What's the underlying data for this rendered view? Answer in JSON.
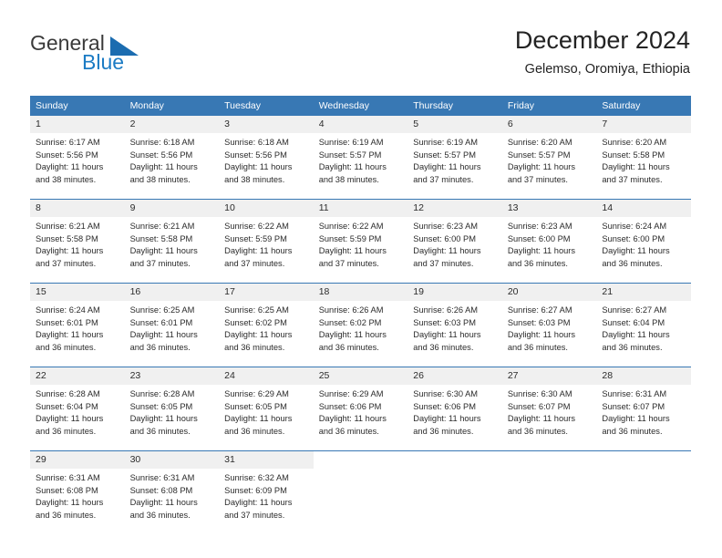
{
  "brand": {
    "name_top": "General",
    "name_bottom": "Blue",
    "accent_color": "#1b7bc4",
    "triangle_color": "#1b6cb0"
  },
  "header": {
    "title": "December 2024",
    "location": "Gelemso, Oromiya, Ethiopia"
  },
  "calendar": {
    "header_bg": "#3878b4",
    "daynum_bg": "#f0f0f0",
    "weekday_headers": [
      "Sunday",
      "Monday",
      "Tuesday",
      "Wednesday",
      "Thursday",
      "Friday",
      "Saturday"
    ],
    "weeks": [
      [
        {
          "day": "1",
          "sunrise": "Sunrise: 6:17 AM",
          "sunset": "Sunset: 5:56 PM",
          "daylight_1": "Daylight: 11 hours",
          "daylight_2": "and 38 minutes."
        },
        {
          "day": "2",
          "sunrise": "Sunrise: 6:18 AM",
          "sunset": "Sunset: 5:56 PM",
          "daylight_1": "Daylight: 11 hours",
          "daylight_2": "and 38 minutes."
        },
        {
          "day": "3",
          "sunrise": "Sunrise: 6:18 AM",
          "sunset": "Sunset: 5:56 PM",
          "daylight_1": "Daylight: 11 hours",
          "daylight_2": "and 38 minutes."
        },
        {
          "day": "4",
          "sunrise": "Sunrise: 6:19 AM",
          "sunset": "Sunset: 5:57 PM",
          "daylight_1": "Daylight: 11 hours",
          "daylight_2": "and 38 minutes."
        },
        {
          "day": "5",
          "sunrise": "Sunrise: 6:19 AM",
          "sunset": "Sunset: 5:57 PM",
          "daylight_1": "Daylight: 11 hours",
          "daylight_2": "and 37 minutes."
        },
        {
          "day": "6",
          "sunrise": "Sunrise: 6:20 AM",
          "sunset": "Sunset: 5:57 PM",
          "daylight_1": "Daylight: 11 hours",
          "daylight_2": "and 37 minutes."
        },
        {
          "day": "7",
          "sunrise": "Sunrise: 6:20 AM",
          "sunset": "Sunset: 5:58 PM",
          "daylight_1": "Daylight: 11 hours",
          "daylight_2": "and 37 minutes."
        }
      ],
      [
        {
          "day": "8",
          "sunrise": "Sunrise: 6:21 AM",
          "sunset": "Sunset: 5:58 PM",
          "daylight_1": "Daylight: 11 hours",
          "daylight_2": "and 37 minutes."
        },
        {
          "day": "9",
          "sunrise": "Sunrise: 6:21 AM",
          "sunset": "Sunset: 5:58 PM",
          "daylight_1": "Daylight: 11 hours",
          "daylight_2": "and 37 minutes."
        },
        {
          "day": "10",
          "sunrise": "Sunrise: 6:22 AM",
          "sunset": "Sunset: 5:59 PM",
          "daylight_1": "Daylight: 11 hours",
          "daylight_2": "and 37 minutes."
        },
        {
          "day": "11",
          "sunrise": "Sunrise: 6:22 AM",
          "sunset": "Sunset: 5:59 PM",
          "daylight_1": "Daylight: 11 hours",
          "daylight_2": "and 37 minutes."
        },
        {
          "day": "12",
          "sunrise": "Sunrise: 6:23 AM",
          "sunset": "Sunset: 6:00 PM",
          "daylight_1": "Daylight: 11 hours",
          "daylight_2": "and 37 minutes."
        },
        {
          "day": "13",
          "sunrise": "Sunrise: 6:23 AM",
          "sunset": "Sunset: 6:00 PM",
          "daylight_1": "Daylight: 11 hours",
          "daylight_2": "and 36 minutes."
        },
        {
          "day": "14",
          "sunrise": "Sunrise: 6:24 AM",
          "sunset": "Sunset: 6:00 PM",
          "daylight_1": "Daylight: 11 hours",
          "daylight_2": "and 36 minutes."
        }
      ],
      [
        {
          "day": "15",
          "sunrise": "Sunrise: 6:24 AM",
          "sunset": "Sunset: 6:01 PM",
          "daylight_1": "Daylight: 11 hours",
          "daylight_2": "and 36 minutes."
        },
        {
          "day": "16",
          "sunrise": "Sunrise: 6:25 AM",
          "sunset": "Sunset: 6:01 PM",
          "daylight_1": "Daylight: 11 hours",
          "daylight_2": "and 36 minutes."
        },
        {
          "day": "17",
          "sunrise": "Sunrise: 6:25 AM",
          "sunset": "Sunset: 6:02 PM",
          "daylight_1": "Daylight: 11 hours",
          "daylight_2": "and 36 minutes."
        },
        {
          "day": "18",
          "sunrise": "Sunrise: 6:26 AM",
          "sunset": "Sunset: 6:02 PM",
          "daylight_1": "Daylight: 11 hours",
          "daylight_2": "and 36 minutes."
        },
        {
          "day": "19",
          "sunrise": "Sunrise: 6:26 AM",
          "sunset": "Sunset: 6:03 PM",
          "daylight_1": "Daylight: 11 hours",
          "daylight_2": "and 36 minutes."
        },
        {
          "day": "20",
          "sunrise": "Sunrise: 6:27 AM",
          "sunset": "Sunset: 6:03 PM",
          "daylight_1": "Daylight: 11 hours",
          "daylight_2": "and 36 minutes."
        },
        {
          "day": "21",
          "sunrise": "Sunrise: 6:27 AM",
          "sunset": "Sunset: 6:04 PM",
          "daylight_1": "Daylight: 11 hours",
          "daylight_2": "and 36 minutes."
        }
      ],
      [
        {
          "day": "22",
          "sunrise": "Sunrise: 6:28 AM",
          "sunset": "Sunset: 6:04 PM",
          "daylight_1": "Daylight: 11 hours",
          "daylight_2": "and 36 minutes."
        },
        {
          "day": "23",
          "sunrise": "Sunrise: 6:28 AM",
          "sunset": "Sunset: 6:05 PM",
          "daylight_1": "Daylight: 11 hours",
          "daylight_2": "and 36 minutes."
        },
        {
          "day": "24",
          "sunrise": "Sunrise: 6:29 AM",
          "sunset": "Sunset: 6:05 PM",
          "daylight_1": "Daylight: 11 hours",
          "daylight_2": "and 36 minutes."
        },
        {
          "day": "25",
          "sunrise": "Sunrise: 6:29 AM",
          "sunset": "Sunset: 6:06 PM",
          "daylight_1": "Daylight: 11 hours",
          "daylight_2": "and 36 minutes."
        },
        {
          "day": "26",
          "sunrise": "Sunrise: 6:30 AM",
          "sunset": "Sunset: 6:06 PM",
          "daylight_1": "Daylight: 11 hours",
          "daylight_2": "and 36 minutes."
        },
        {
          "day": "27",
          "sunrise": "Sunrise: 6:30 AM",
          "sunset": "Sunset: 6:07 PM",
          "daylight_1": "Daylight: 11 hours",
          "daylight_2": "and 36 minutes."
        },
        {
          "day": "28",
          "sunrise": "Sunrise: 6:31 AM",
          "sunset": "Sunset: 6:07 PM",
          "daylight_1": "Daylight: 11 hours",
          "daylight_2": "and 36 minutes."
        }
      ],
      [
        {
          "day": "29",
          "sunrise": "Sunrise: 6:31 AM",
          "sunset": "Sunset: 6:08 PM",
          "daylight_1": "Daylight: 11 hours",
          "daylight_2": "and 36 minutes."
        },
        {
          "day": "30",
          "sunrise": "Sunrise: 6:31 AM",
          "sunset": "Sunset: 6:08 PM",
          "daylight_1": "Daylight: 11 hours",
          "daylight_2": "and 36 minutes."
        },
        {
          "day": "31",
          "sunrise": "Sunrise: 6:32 AM",
          "sunset": "Sunset: 6:09 PM",
          "daylight_1": "Daylight: 11 hours",
          "daylight_2": "and 37 minutes."
        },
        {
          "day": "",
          "sunrise": "",
          "sunset": "",
          "daylight_1": "",
          "daylight_2": ""
        },
        {
          "day": "",
          "sunrise": "",
          "sunset": "",
          "daylight_1": "",
          "daylight_2": ""
        },
        {
          "day": "",
          "sunrise": "",
          "sunset": "",
          "daylight_1": "",
          "daylight_2": ""
        },
        {
          "day": "",
          "sunrise": "",
          "sunset": "",
          "daylight_1": "",
          "daylight_2": ""
        }
      ]
    ]
  }
}
